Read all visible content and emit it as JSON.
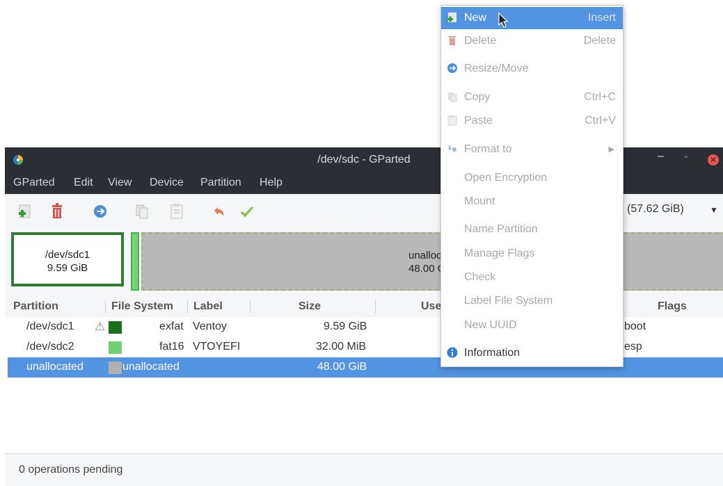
{
  "window": {
    "title": "/dev/sdc - GParted",
    "controls": {
      "minimize": "–",
      "maximize": "▫",
      "close": "✕"
    }
  },
  "menubar": [
    "GParted",
    "Edit",
    "View",
    "Device",
    "Partition",
    "Help"
  ],
  "toolbar": {
    "icons": [
      "new-partition-icon",
      "delete-icon",
      "resize-move-icon",
      "copy-icon",
      "paste-icon",
      "undo-icon",
      "apply-icon"
    ],
    "device_select": "lc (57.62 GiB)"
  },
  "partition_map": {
    "sdc1": {
      "name": "/dev/sdc1",
      "size": "9.59 GiB"
    },
    "unallocated": {
      "name": "unalloc",
      "size": "48.00 G"
    }
  },
  "table": {
    "headers": [
      "Partition",
      "File System",
      "Label",
      "Size",
      "Use",
      "Flags"
    ],
    "rows": [
      {
        "partition": "/dev/sdc1",
        "warn": "⚠",
        "color": "#1b6e1b",
        "filesystem": "exfat",
        "label": "Ventoy",
        "size": "9.59 GiB",
        "flags": "boot"
      },
      {
        "partition": "/dev/sdc2",
        "warn": "",
        "color": "#6fd16f",
        "filesystem": "fat16",
        "label": "VTOYEFI",
        "size": "32.00 MiB",
        "flags": "esp"
      },
      {
        "partition": "unallocated",
        "warn": "",
        "color": "#b0b0b0",
        "filesystem": "unallocated",
        "label": "",
        "size": "48.00 GiB",
        "flags": ""
      }
    ]
  },
  "status": "0 operations pending",
  "context_menu": {
    "new": {
      "label": "New",
      "accel": "Insert"
    },
    "delete": {
      "label": "Delete",
      "accel": "Delete"
    },
    "resize": {
      "label": "Resize/Move"
    },
    "copy": {
      "label": "Copy",
      "accel": "Ctrl+C"
    },
    "paste": {
      "label": "Paste",
      "accel": "Ctrl+V"
    },
    "format": {
      "label": "Format to"
    },
    "open_encryption": {
      "label": "Open Encryption"
    },
    "mount": {
      "label": "Mount"
    },
    "name_partition": {
      "label": "Name Partition"
    },
    "manage_flags": {
      "label": "Manage Flags"
    },
    "check": {
      "label": "Check"
    },
    "label_fs": {
      "label": "Label File System"
    },
    "new_uuid": {
      "label": "New UUID"
    },
    "information": {
      "label": "Information"
    }
  },
  "colors": {
    "selection": "#5294e2",
    "titlebar": "#2b2e33",
    "close": "#f0544f"
  }
}
